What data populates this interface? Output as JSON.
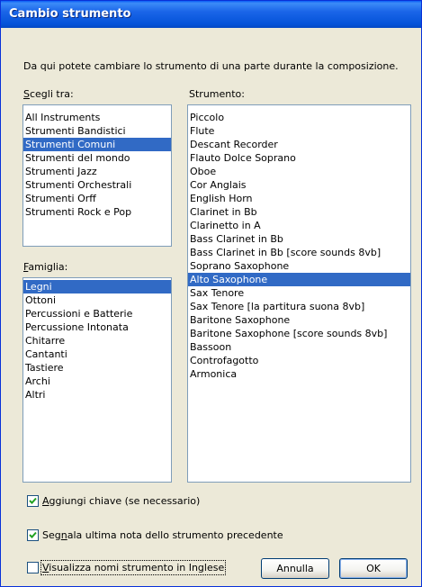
{
  "window": {
    "title": "Cambio strumento",
    "description": "Da qui potete cambiare lo strumento di una parte durante la composizione."
  },
  "choose_from": {
    "label": "Scegli tra:",
    "items": [
      {
        "label": "All Instruments",
        "selected": false
      },
      {
        "label": "Strumenti Bandistici",
        "selected": false
      },
      {
        "label": "Strumenti Comuni",
        "selected": true
      },
      {
        "label": "Strumenti del mondo",
        "selected": false
      },
      {
        "label": "Strumenti Jazz",
        "selected": false
      },
      {
        "label": "Strumenti Orchestrali",
        "selected": false
      },
      {
        "label": "Strumenti Orff",
        "selected": false
      },
      {
        "label": "Strumenti Rock e Pop",
        "selected": false
      }
    ]
  },
  "family": {
    "label": "Famiglia:",
    "items": [
      {
        "label": "Legni",
        "selected": true
      },
      {
        "label": "Ottoni",
        "selected": false
      },
      {
        "label": "Percussioni e Batterie",
        "selected": false
      },
      {
        "label": "Percussione Intonata",
        "selected": false
      },
      {
        "label": "Chitarre",
        "selected": false
      },
      {
        "label": "Cantanti",
        "selected": false
      },
      {
        "label": "Tastiere",
        "selected": false
      },
      {
        "label": "Archi",
        "selected": false
      },
      {
        "label": "Altri",
        "selected": false
      }
    ]
  },
  "instrument": {
    "label": "Strumento:",
    "items": [
      {
        "label": "Piccolo",
        "selected": false
      },
      {
        "label": "Flute",
        "selected": false
      },
      {
        "label": "Descant Recorder",
        "selected": false
      },
      {
        "label": "Flauto Dolce Soprano",
        "selected": false
      },
      {
        "label": "Oboe",
        "selected": false
      },
      {
        "label": "Cor Anglais",
        "selected": false
      },
      {
        "label": "English Horn",
        "selected": false
      },
      {
        "label": "Clarinet in Bb",
        "selected": false
      },
      {
        "label": "Clarinetto in A",
        "selected": false
      },
      {
        "label": "Bass Clarinet in Bb",
        "selected": false
      },
      {
        "label": "Bass Clarinet in Bb [score sounds 8vb]",
        "selected": false
      },
      {
        "label": "Soprano Saxophone",
        "selected": false
      },
      {
        "label": "Alto Saxophone",
        "selected": true
      },
      {
        "label": "Sax Tenore",
        "selected": false
      },
      {
        "label": "Sax Tenore [la partitura suona 8vb]",
        "selected": false
      },
      {
        "label": "Baritone Saxophone",
        "selected": false
      },
      {
        "label": "Baritone Saxophone [score sounds 8vb]",
        "selected": false
      },
      {
        "label": "Bassoon",
        "selected": false
      },
      {
        "label": "Controfagotto",
        "selected": false
      },
      {
        "label": "Armonica",
        "selected": false
      }
    ]
  },
  "options": {
    "add_clef": {
      "label": "Aggiungi chiave (se necessario)",
      "checked": true
    },
    "mark_last_note": {
      "label": "Segnala ultima nota dello strumento precedente",
      "checked": true
    },
    "english_names": {
      "label": "Visualizza nomi strumento in Inglese",
      "checked": false
    }
  },
  "buttons": {
    "cancel": "Annulla",
    "ok": "OK"
  }
}
